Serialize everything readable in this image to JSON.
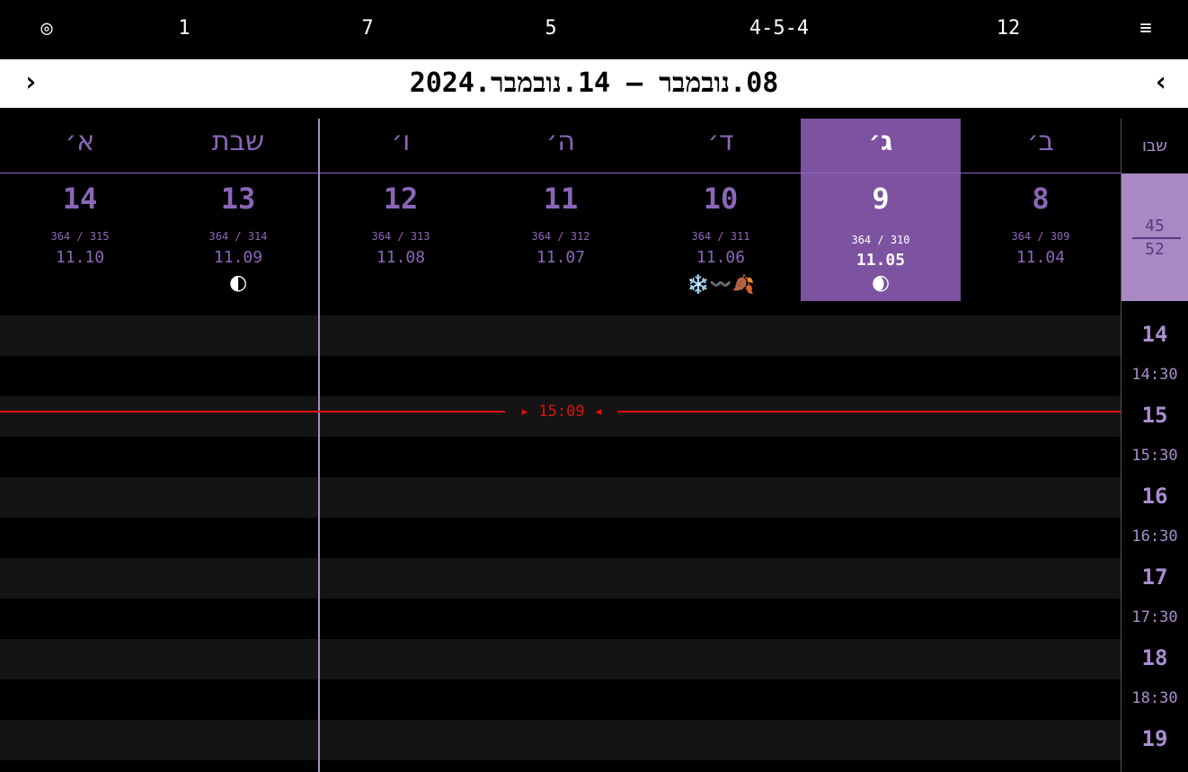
{
  "topbar": {
    "target_icon": "◎",
    "item_1": "1",
    "item_7": "7",
    "item_5": "5",
    "item_454": "4-5-4",
    "item_12": "12",
    "menu_icon": "≡"
  },
  "header": {
    "prev": "‹",
    "next": "›",
    "title": "08.נובמבר — 14.נובמבר.2024"
  },
  "week": {
    "label": "שבו",
    "number": "45",
    "total": "52"
  },
  "days": [
    {
      "name": "ב׳",
      "num": "8",
      "year": "364 / 309",
      "date": "11.04",
      "icon": ""
    },
    {
      "name": "ג׳",
      "num": "9",
      "year": "364 / 310",
      "date": "11.05",
      "icon": "🌒",
      "today": true
    },
    {
      "name": "ד׳",
      "num": "10",
      "year": "364 / 311",
      "date": "11.06",
      "icon": "❄️〰️🍂"
    },
    {
      "name": "ה׳",
      "num": "11",
      "year": "364 / 312",
      "date": "11.07",
      "icon": ""
    },
    {
      "name": "ו׳",
      "num": "12",
      "year": "364 / 313",
      "date": "11.08",
      "icon": ""
    },
    {
      "name": "שבת",
      "num": "13",
      "year": "364 / 314",
      "date": "11.09",
      "icon": "🌓"
    },
    {
      "name": "א׳",
      "num": "14",
      "year": "364 / 315",
      "date": "11.10",
      "icon": ""
    }
  ],
  "hours": [
    "14",
    "14:30",
    "15",
    "15:30",
    "16",
    "16:30",
    "17",
    "17:30",
    "18",
    "18:30",
    "19"
  ],
  "now": {
    "label": "15:09",
    "arrow_left": "▸",
    "arrow_right": "◂"
  },
  "colors": {
    "accent": "#7d52a0",
    "accent_light": "#a889c4",
    "now_line": "#e01010"
  }
}
